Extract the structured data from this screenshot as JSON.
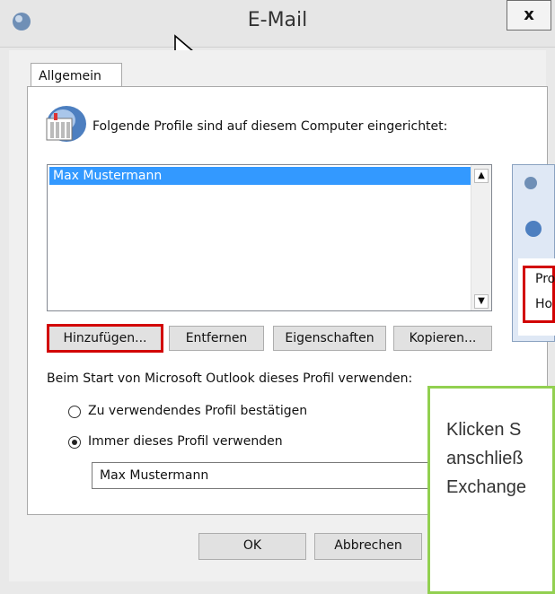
{
  "window": {
    "title": "E-Mail",
    "close_label": "x"
  },
  "tabs": [
    {
      "label": "Allgemein"
    }
  ],
  "profiles": {
    "description": "Folgende Profile sind auf diesem Computer eingerichtet:",
    "items": [
      "Max Mustermann"
    ]
  },
  "buttons": {
    "add": "Hinzufügen...",
    "remove": "Entfernen",
    "properties": "Eigenschaften",
    "copy": "Kopieren...",
    "ok": "OK",
    "cancel": "Abbrechen"
  },
  "startup": {
    "label": "Beim Start von Microsoft Outlook dieses Profil verwenden:",
    "option_confirm": "Zu verwendendes Profil bestätigen",
    "option_always": "Immer dieses Profil verwenden",
    "selected_profile": "Max Mustermann"
  },
  "popup": {
    "line1": "Pro",
    "line2": "Ho"
  },
  "callout": {
    "line1": "Klicken S",
    "line2": "anschließ",
    "line3": "Exchange"
  },
  "colors": {
    "selection": "#3399ff",
    "highlight_red": "#d20000",
    "callout_green": "#92d050"
  }
}
